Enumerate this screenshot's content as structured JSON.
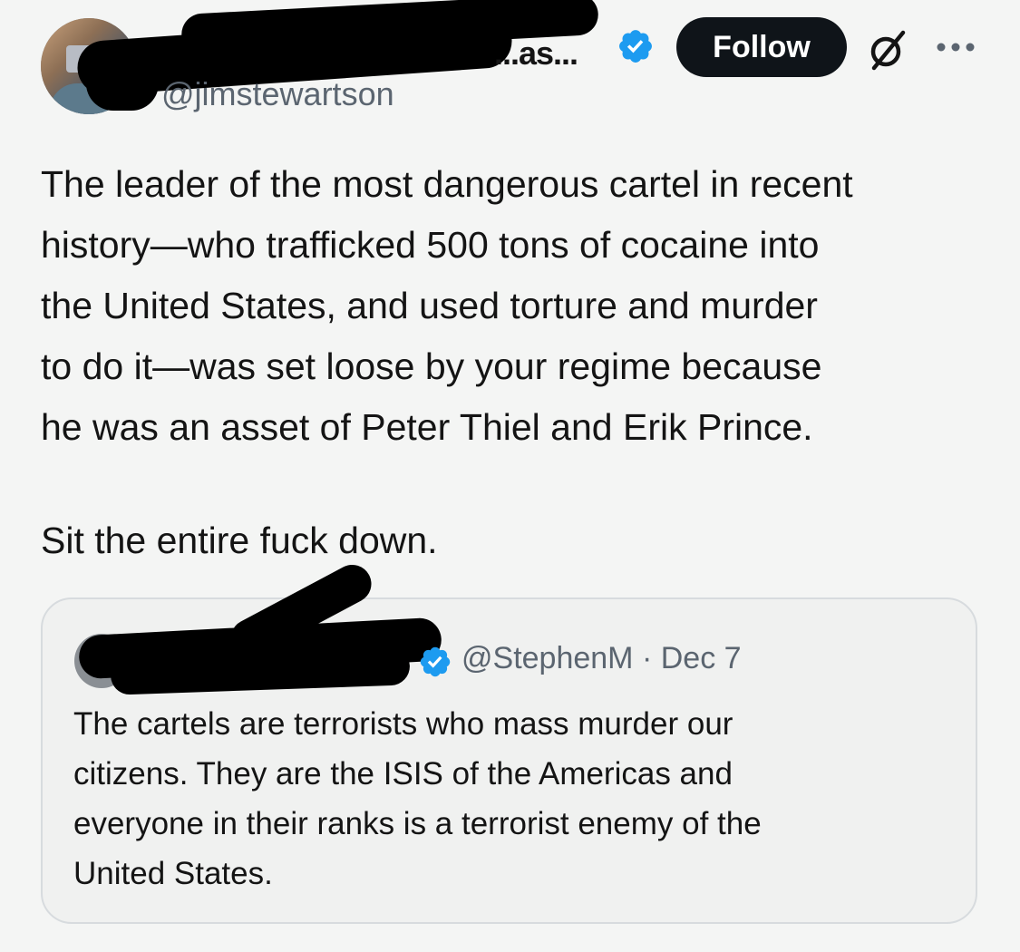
{
  "post": {
    "author_name_visible_tail": "...as...",
    "author_handle": "@jimstewartson",
    "follow_label": "Follow",
    "body_lines": [
      "The leader of the most dangerous cartel in recent",
      "history—who trafficked 500 tons of cocaine into",
      "the United States, and used torture and murder",
      "to do it—was set loose by your regime because",
      "he was an asset of Peter Thiel and Erik Prince."
    ],
    "closing_line": "Sit the entire fuck down."
  },
  "quoted_post": {
    "handle": "@StephenM",
    "separator": "·",
    "date": "Dec 7",
    "body_lines": [
      "The cartels are terrorists who mass murder our",
      "citizens. They are the ISIS of the Americas and",
      "everyone in their ranks is a terrorist enemy of the",
      "United States."
    ]
  },
  "icons": {
    "verified": "verified-badge-icon",
    "grok": "grok-icon",
    "more": "more-options-icon"
  },
  "colors": {
    "verified_blue": "#1d9bf0",
    "follow_bg": "#0f1419",
    "handle_gray": "#5b6570"
  }
}
